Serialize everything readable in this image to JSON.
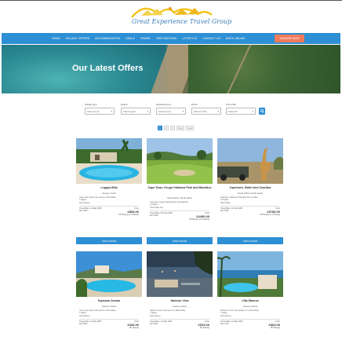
{
  "brand": {
    "logo_text": "Great Experience Travel Group"
  },
  "nav": {
    "items": [
      "Home",
      "Holiday Offers",
      "Accommodation",
      "Deals",
      "Travel",
      "Destinations",
      "Lifestyle",
      "Contact Us",
      "Book Online"
    ],
    "cta": "Enquire Now"
  },
  "hero": {
    "title": "Our Latest Offers"
  },
  "filters": [
    {
      "label": "Holiday type",
      "value": "Select an ok"
    },
    {
      "label": "Region",
      "value": "Select region"
    },
    {
      "label": "Departing From",
      "value": "Select an ok"
    },
    {
      "label": "Month",
      "value": "Select month"
    },
    {
      "label": "Price Filter",
      "value": "Select all"
    }
  ],
  "search_icon": "search-icon",
  "pagination": [
    "1",
    "2",
    "3",
    "Next",
    "Last"
  ],
  "cards": [
    {
      "title": "Luppya Billa",
      "location": "Greece, Corfu",
      "lines": [
        "Come and relax by the pool in a villa holiday",
        "7 Nights",
        "Self catering"
      ],
      "travel": "Travel Date / 14 May 2025",
      "date": "Ref: 7842",
      "price_label": "From",
      "price": "£808.00",
      "pp": "PP Sharing or 2 Sharing"
    },
    {
      "title": "Cape Town, Kruger National Park and Mauritius",
      "location": "South Africa, South Africa",
      "lines": [
        "Capetown, Kruger National Park and Mauritius",
        "12 Nights",
        "Tailor Made Trip"
      ],
      "travel": "Travel Date / 30 June 2025",
      "date": "Ref: 1294",
      "price_label": "From",
      "price": "£4450.00",
      "pp": "PP Sharing or 2 Sharing"
    },
    {
      "title": "Capetown, Safari And Zanzibar",
      "location": "South Africa, South Island",
      "lines": [
        "Capetown, Safari And Zanzibar Tour on Offer",
        "14 Nights",
        "Tailor Made"
      ],
      "travel": "Travel Date / 12 July 2025",
      "date": "Ref: 3381",
      "price_label": "From",
      "price": "£3789.00",
      "pp": "PP Sharing or 2 Sharing"
    },
    {
      "title": "Kapsana Osman",
      "location": "Greece, Paxos",
      "lines": [
        "Come and relax by the pool in a villa holiday",
        "7 Nights",
        "Self catering"
      ],
      "travel": "Travel Date / 14 May 2025",
      "date": "Ref: 5510",
      "price_label": "From",
      "price": "£946.00",
      "pp": "PP Sharing"
    },
    {
      "title": "Harbour View",
      "location": "Greece, Paxos",
      "lines": [
        "Harbour views by the pool in a villa holiday",
        "7 Nights",
        "Self catering"
      ],
      "travel": "Travel Date / 14 May 2025",
      "date": "Ref: 6621",
      "price_label": "From",
      "price": "£923.00",
      "pp": "PP Sharing"
    },
    {
      "title": "Villa Stavros",
      "location": "Greece, Paxos",
      "lines": [
        "Welcome to DIY pool position in a villa holiday",
        "7 Nights",
        "Self catering"
      ],
      "travel": "Travel Date / 14 May 2025",
      "date": "Ref: 7732",
      "price_label": "From",
      "price": "£863.00",
      "pp": "PP Sharing"
    }
  ],
  "card_button": "View Offer",
  "colors": {
    "primary": "#2d8fd4",
    "cta": "#f07a5a"
  }
}
